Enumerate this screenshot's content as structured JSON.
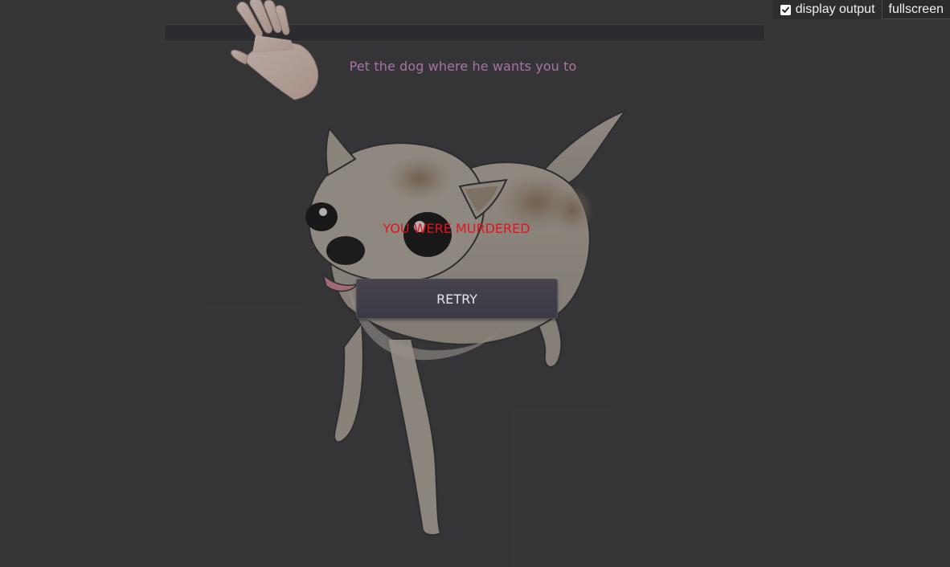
{
  "controls": {
    "display_output_label": "display output",
    "display_output_checked": true,
    "fullscreen_label": "fullscreen"
  },
  "game": {
    "instruction": "Pet the dog where he wants you to",
    "progress": 0,
    "death_message": "YOU WERE MURDERED",
    "retry_label": "RETRY"
  },
  "colors": {
    "background": "#363538",
    "instruction_text": "#d98fd0",
    "death_text": "#e0141e",
    "button_bg": "#423f4b"
  },
  "icons": {
    "hand": "hand-icon",
    "dog": "chihuahua-sprite",
    "checkbox": "checkmark-icon"
  }
}
